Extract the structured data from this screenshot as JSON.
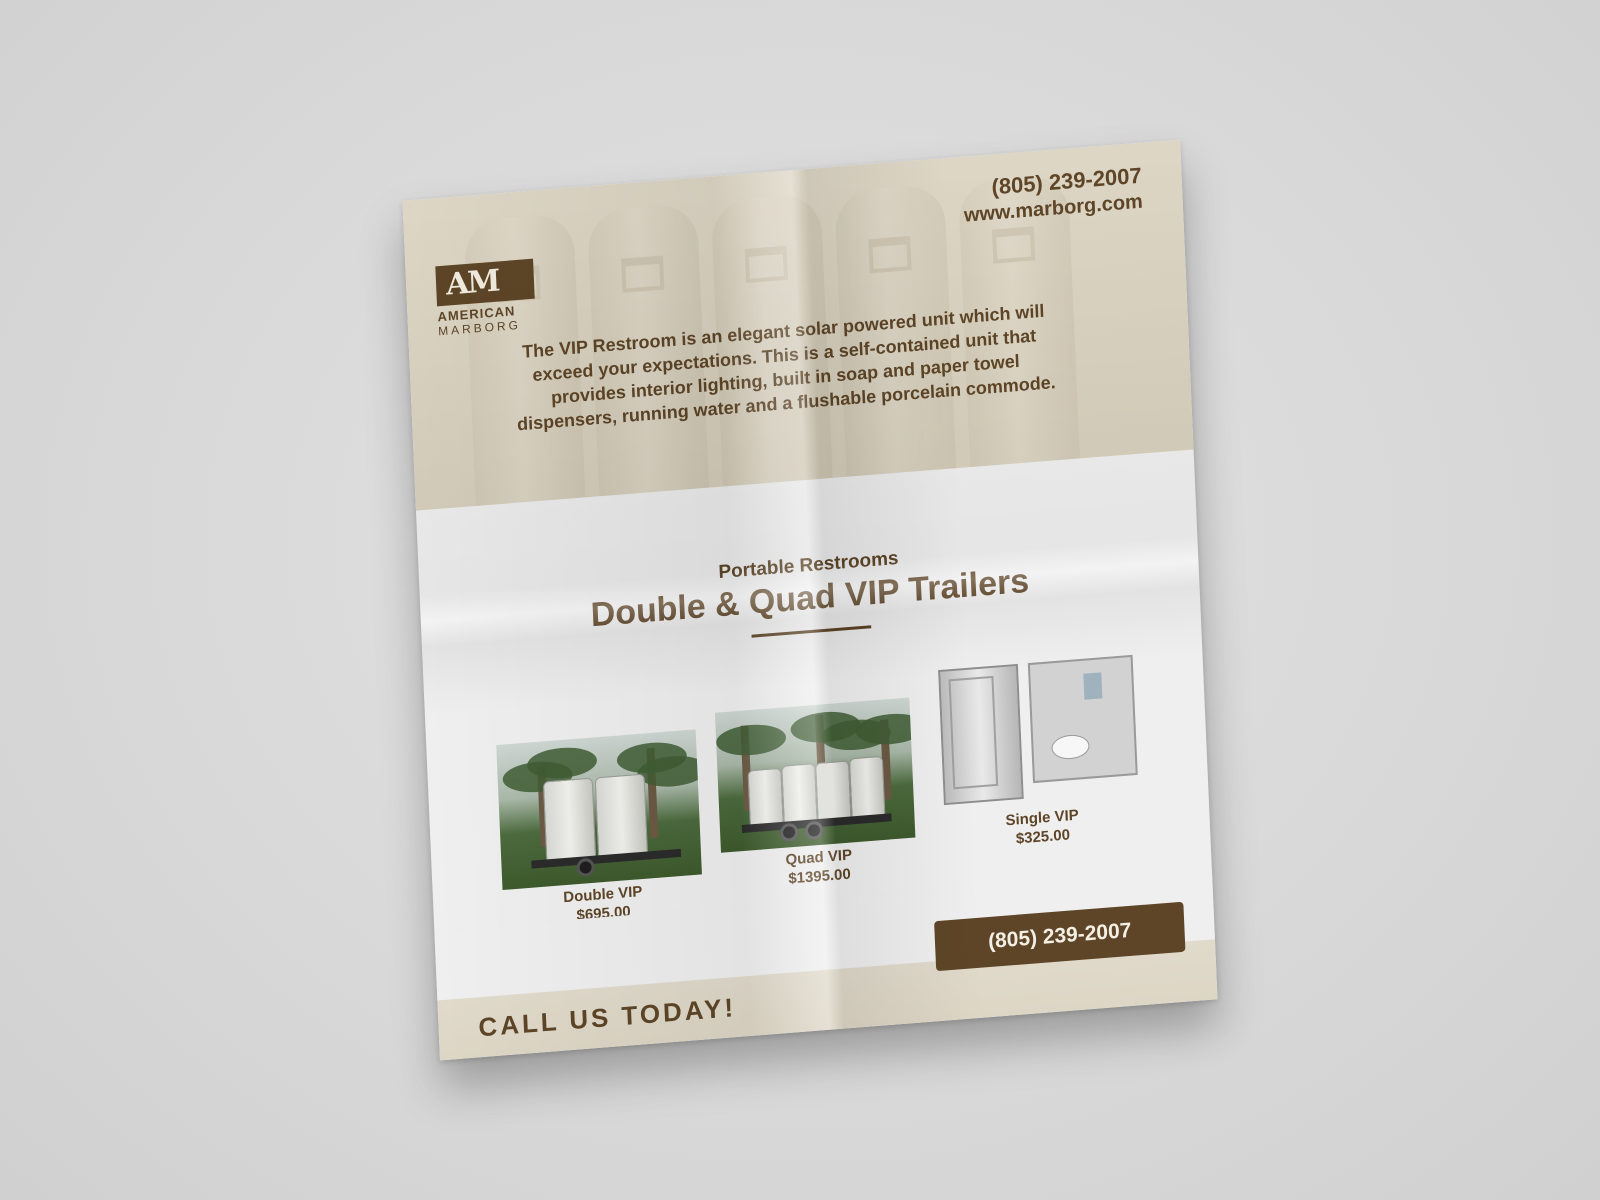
{
  "header": {
    "phone": "(805) 239-2007",
    "website": "www.marborg.com"
  },
  "logo": {
    "letters": "AM",
    "name_line1": "AMERICAN",
    "name_line2": "MARBORG",
    "bg_color": "#5e4527"
  },
  "intro_text": "The VIP Restroom is an elegant solar powered unit which will exceed your expectations. This is a self-contained unit that provides interior lighting, built in soap and paper towel dispensers, running water and a flushable porcelain commode.",
  "section": {
    "subheading": "Portable Restrooms",
    "title": "Double & Quad VIP Trailers"
  },
  "products": [
    {
      "name": "Double VIP",
      "price": "$695.00"
    },
    {
      "name": "Quad VIP",
      "price": "$1395.00"
    },
    {
      "name": "Single VIP",
      "price": "$325.00"
    }
  ],
  "cta": {
    "phone": "(805) 239-2007",
    "text": "CALL US TODAY!"
  },
  "colors": {
    "brand_brown": "#5e4527",
    "band_beige": "#d8d0bd",
    "paper": "#efefef",
    "background": "#d9d9d9"
  }
}
